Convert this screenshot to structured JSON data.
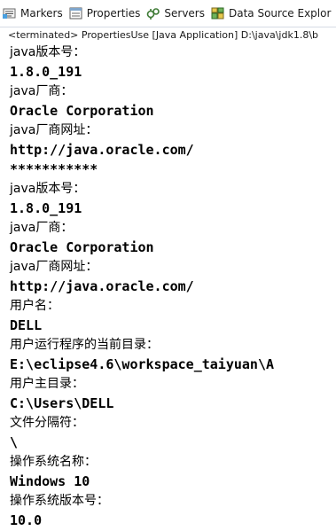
{
  "tabs": [
    {
      "label": "Markers",
      "icon": "markers-icon"
    },
    {
      "label": "Properties",
      "icon": "properties-icon"
    },
    {
      "label": "Servers",
      "icon": "servers-icon"
    },
    {
      "label": "Data Source Explor",
      "icon": "data-source-icon"
    }
  ],
  "console_header": "<terminated> PropertiesUse [Java Application] D:\\java\\jdk1.8\\b",
  "output_lines": [
    "java版本号：",
    "1.8.0_191",
    "java厂商：",
    "Oracle Corporation",
    "java厂商网址：",
    "http://java.oracle.com/",
    "***********",
    "java版本号：",
    "1.8.0_191",
    "java厂商：",
    "Oracle Corporation",
    "java厂商网址：",
    "http://java.oracle.com/",
    "用户名：",
    "DELL",
    "用户运行程序的当前目录：",
    "E:\\eclipse4.6\\workspace_taiyuan\\A",
    "用户主目录：",
    "C:\\Users\\DELL",
    "文件分隔符：",
    "\\",
    "操作系统名称：",
    "Windows 10",
    "操作系统版本号：",
    "10.0"
  ]
}
